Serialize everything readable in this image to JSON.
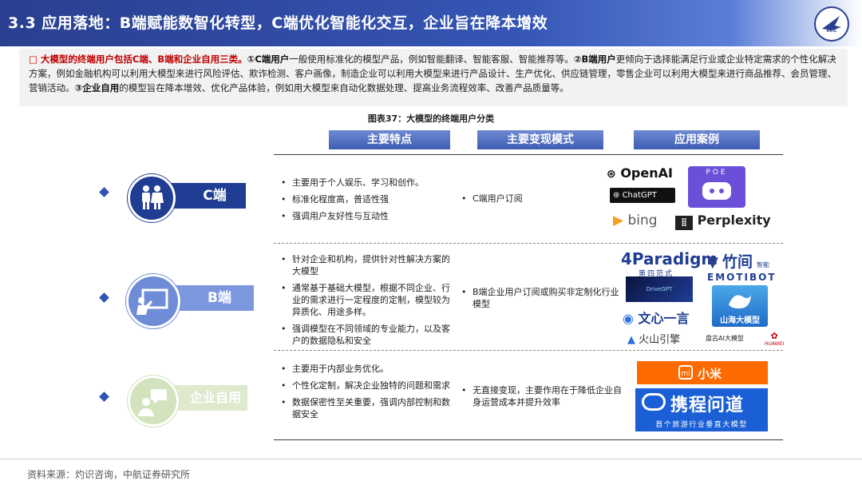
{
  "header": {
    "title": "3.3 应用落地：B端赋能数智化转型，C端优化智能化交互，企业旨在降本增效",
    "logo_text": "AVIC"
  },
  "intro": {
    "lead": "大模型的终端用户包括C端、B端和企业自用三类。",
    "p1_num": "①",
    "p1_bold": "C端用户",
    "p1_text": "一般使用标准化的模型产品，例如智能翻译、智能客服、智能推荐等。",
    "p2_num": "②",
    "p2_bold": "B端用户",
    "p2_text": "更倾向于选择能满足行业或企业特定需求的个性化解决方案，例如金融机构可以利用大模型来进行风险评估、欺诈检测、客户画像，制造企业可以利用大模型来进行产品设计、生产优化、供应链管理，零售企业可以利用大模型来进行商品推荐、会员管理、营销活动。",
    "p3_num": "③",
    "p3_bold": "企业自用",
    "p3_text": "的模型旨在降本增效、优化产品体验，例如用大模型来自动化数据处理、提高业务流程效率、改善产品质量等。"
  },
  "figure": {
    "title": "图表37：大模型的终端用户分类",
    "columns": [
      "主要特点",
      "主要变现模式",
      "应用案例"
    ]
  },
  "rows": [
    {
      "label": "C端",
      "features": [
        "主要用于个人娱乐、学习和创作。",
        "标准化程度高，普适性强",
        "强调用户友好性与互动性"
      ],
      "mode": "C端用户订阅",
      "logos": [
        "OpenAI",
        "POE",
        "ChatGPT",
        "bing",
        "Perplexity"
      ]
    },
    {
      "label": "B端",
      "features": [
        "针对企业和机构，提供针对性解决方案的大模型",
        "通常基于基础大模型，根据不同企业、行业的需求进行一定程度的定制，模型较为异质化、用途多样。",
        "强调模型在不同领域的专业能力，以及客户的数据隐私和安全"
      ],
      "mode": "B端企业用户订阅或购买非定制化行业模型",
      "logos": [
        "4Paradigm",
        "第四范式",
        "竹间",
        "智能",
        "EMOTIBOT",
        "DriveGPT",
        "文心一言",
        "山海大模型",
        "火山引擎",
        "盘古AI大模型",
        "HUAWEI"
      ]
    },
    {
      "label": "企业自用",
      "features": [
        "主要用于内部业务优化。",
        "个性化定制，解决企业独特的问题和需求",
        "数据保密性至关重要，强调内部控制和数据安全"
      ],
      "mode": "无直接变现，主要作用在于降低企业自身运营成本并提升效率",
      "logos": [
        "mi",
        "小米",
        "携程问道",
        "首个旅游行业垂直大模型"
      ]
    }
  ],
  "source": "资料来源：灼识咨询，中航证券研究所",
  "colors": {
    "brand": "#2a3f8f",
    "accent": "#2f55b4",
    "red": "#c00000"
  }
}
